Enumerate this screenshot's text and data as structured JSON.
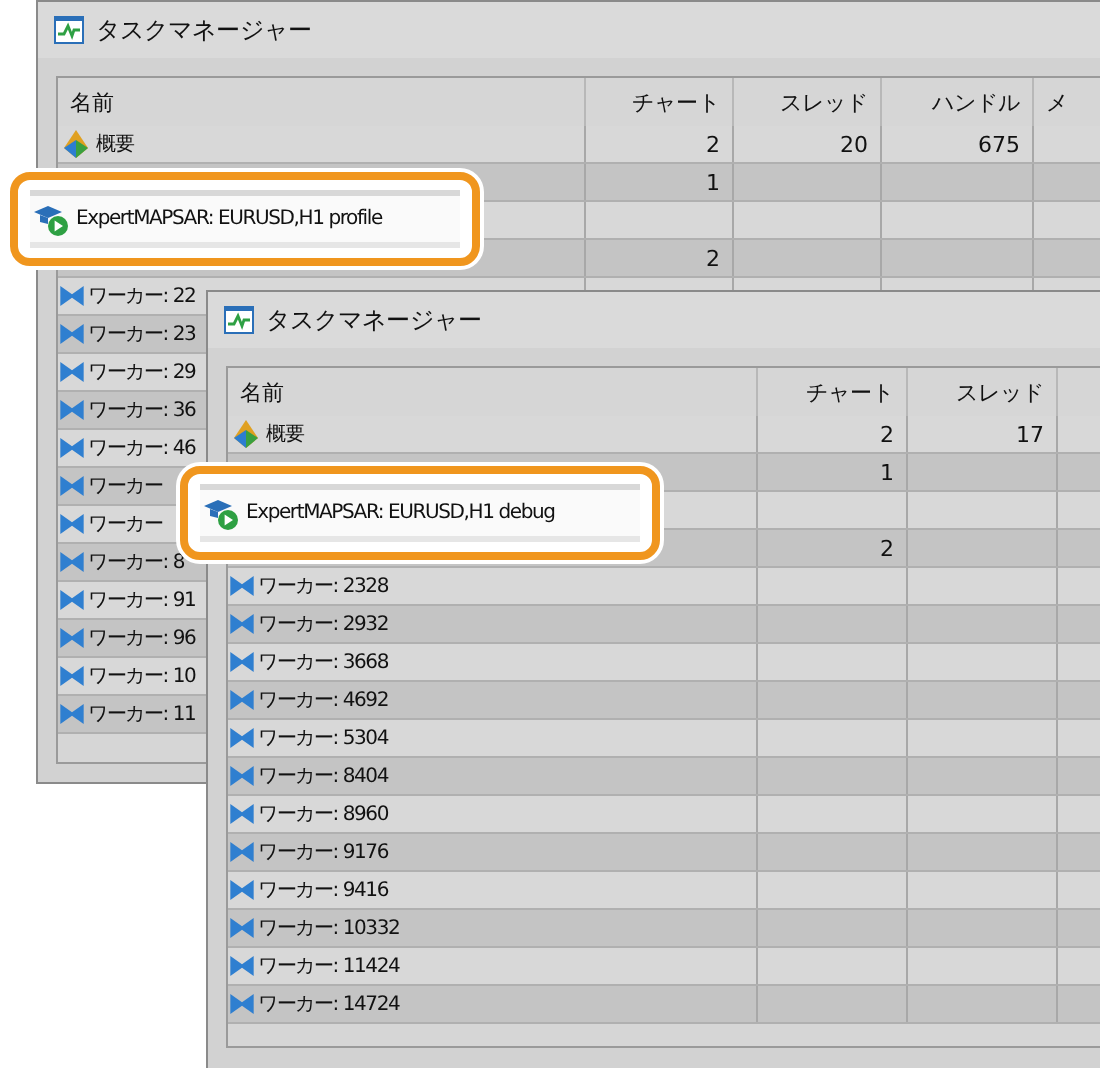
{
  "windows": [
    {
      "title": "タスクマネージャー",
      "columns": [
        "名前",
        "チャート",
        "スレッド",
        "ハンドル",
        "メ"
      ],
      "rows": [
        {
          "kind": "summary",
          "name": "概要",
          "cells": [
            "2",
            "20",
            "675"
          ]
        },
        {
          "kind": "covered",
          "cells": [
            "1"
          ]
        },
        {
          "kind": "covered"
        },
        {
          "kind": "covered",
          "cells": [
            "2"
          ]
        },
        {
          "kind": "worker",
          "name": "ワーカー: 22"
        },
        {
          "kind": "worker",
          "name": "ワーカー: 23"
        },
        {
          "kind": "worker",
          "name": "ワーカー: 29"
        },
        {
          "kind": "worker",
          "name": "ワーカー: 36"
        },
        {
          "kind": "worker",
          "name": "ワーカー: 46"
        },
        {
          "kind": "worker",
          "name": "ワーカー"
        },
        {
          "kind": "worker",
          "name": "ワーカー"
        },
        {
          "kind": "worker",
          "name": "ワーカー: 8"
        },
        {
          "kind": "worker",
          "name": "ワーカー: 91"
        },
        {
          "kind": "worker",
          "name": "ワーカー: 96"
        },
        {
          "kind": "worker",
          "name": "ワーカー: 10"
        },
        {
          "kind": "worker",
          "name": "ワーカー: 11"
        }
      ],
      "callout": {
        "label": "ExpertMAPSAR: EURUSD,H1 profile"
      }
    },
    {
      "title": "タスクマネージャー",
      "columns": [
        "名前",
        "チャート",
        "スレッド"
      ],
      "rows": [
        {
          "kind": "summary",
          "name": "概要",
          "cells": [
            "2",
            "17"
          ]
        },
        {
          "kind": "covered",
          "cells": [
            "1"
          ]
        },
        {
          "kind": "covered"
        },
        {
          "kind": "covered",
          "cells": [
            "2"
          ]
        },
        {
          "kind": "worker",
          "name": "ワーカー: 2328"
        },
        {
          "kind": "worker",
          "name": "ワーカー: 2932"
        },
        {
          "kind": "worker",
          "name": "ワーカー: 3668"
        },
        {
          "kind": "worker",
          "name": "ワーカー: 4692"
        },
        {
          "kind": "worker",
          "name": "ワーカー: 5304"
        },
        {
          "kind": "worker",
          "name": "ワーカー: 8404"
        },
        {
          "kind": "worker",
          "name": "ワーカー: 8960"
        },
        {
          "kind": "worker",
          "name": "ワーカー: 9176"
        },
        {
          "kind": "worker",
          "name": "ワーカー: 9416"
        },
        {
          "kind": "worker",
          "name": "ワーカー: 10332"
        },
        {
          "kind": "worker",
          "name": "ワーカー: 11424"
        },
        {
          "kind": "worker",
          "name": "ワーカー: 14724"
        }
      ],
      "callout": {
        "label": "ExpertMAPSAR: EURUSD,H1 debug"
      }
    }
  ]
}
